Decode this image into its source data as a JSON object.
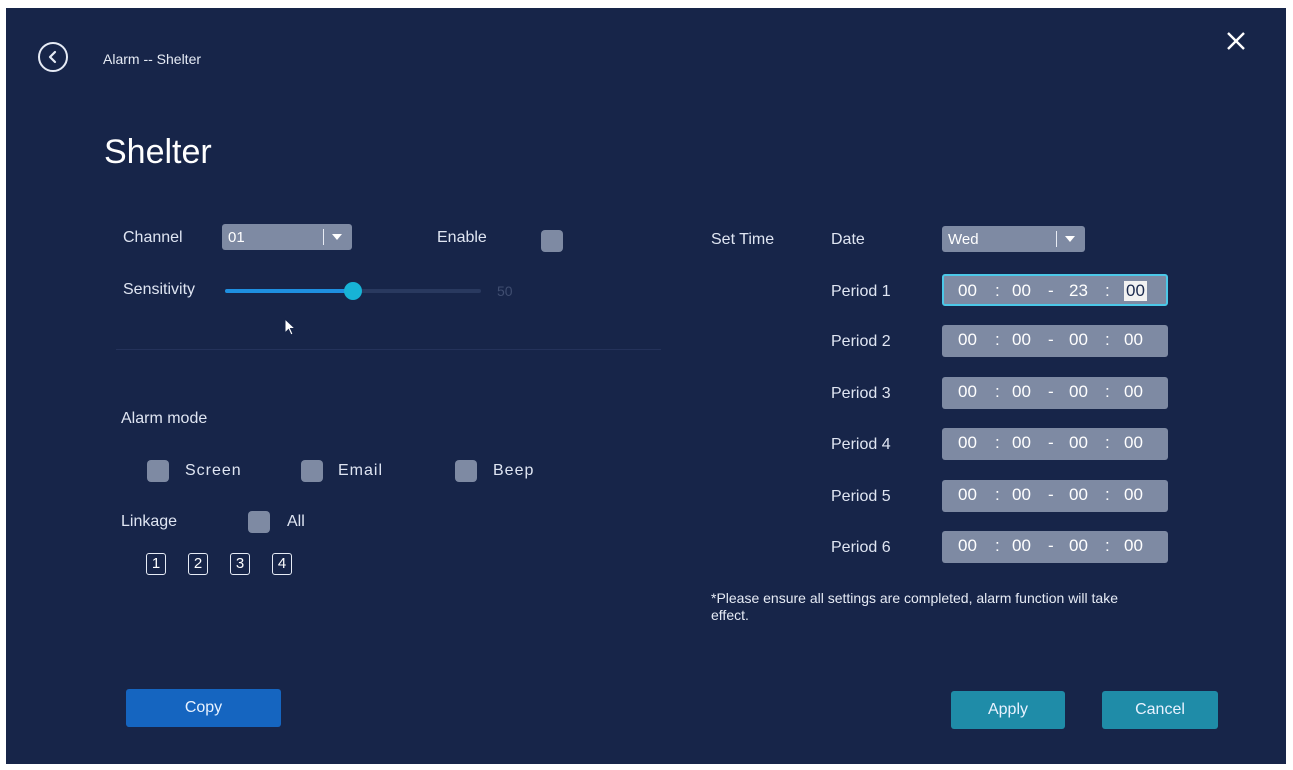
{
  "header": {
    "breadcrumb": "Alarm -- Shelter",
    "title": "Shelter"
  },
  "left": {
    "channel_label": "Channel",
    "channel_value": "01",
    "enable_label": "Enable",
    "sensitivity_label": "Sensitivity",
    "sensitivity_value": "50",
    "sensitivity_fraction": 0.5,
    "alarm_mode_label": "Alarm mode",
    "modes": [
      {
        "label": "Screen"
      },
      {
        "label": "Email"
      },
      {
        "label": "Beep"
      }
    ],
    "linkage_label": "Linkage",
    "all_label": "All",
    "channels": [
      "1",
      "2",
      "3",
      "4"
    ]
  },
  "right": {
    "set_time_label": "Set Time",
    "date_label": "Date",
    "date_value": "Wed",
    "periods": [
      {
        "label": "Period 1",
        "h1": "00",
        "m1": "00",
        "h2": "23",
        "m2": "00"
      },
      {
        "label": "Period 2",
        "h1": "00",
        "m1": "00",
        "h2": "00",
        "m2": "00"
      },
      {
        "label": "Period 3",
        "h1": "00",
        "m1": "00",
        "h2": "00",
        "m2": "00"
      },
      {
        "label": "Period 4",
        "h1": "00",
        "m1": "00",
        "h2": "00",
        "m2": "00"
      },
      {
        "label": "Period 5",
        "h1": "00",
        "m1": "00",
        "h2": "00",
        "m2": "00"
      },
      {
        "label": "Period 6",
        "h1": "00",
        "m1": "00",
        "h2": "00",
        "m2": "00"
      }
    ],
    "note": "*Please ensure all settings are completed, alarm function will take effect."
  },
  "buttons": {
    "copy": "Copy",
    "apply": "Apply",
    "cancel": "Cancel"
  },
  "icons": {
    "back": "back-arrow-icon",
    "close": "close-icon",
    "pointer": "mouse-pointer-icon"
  },
  "colors": {
    "background": "#172549",
    "control": "#7e8aa3",
    "accent": "#17b3d6",
    "copy_button": "#1565c0",
    "action_button": "#1f8ca8"
  }
}
